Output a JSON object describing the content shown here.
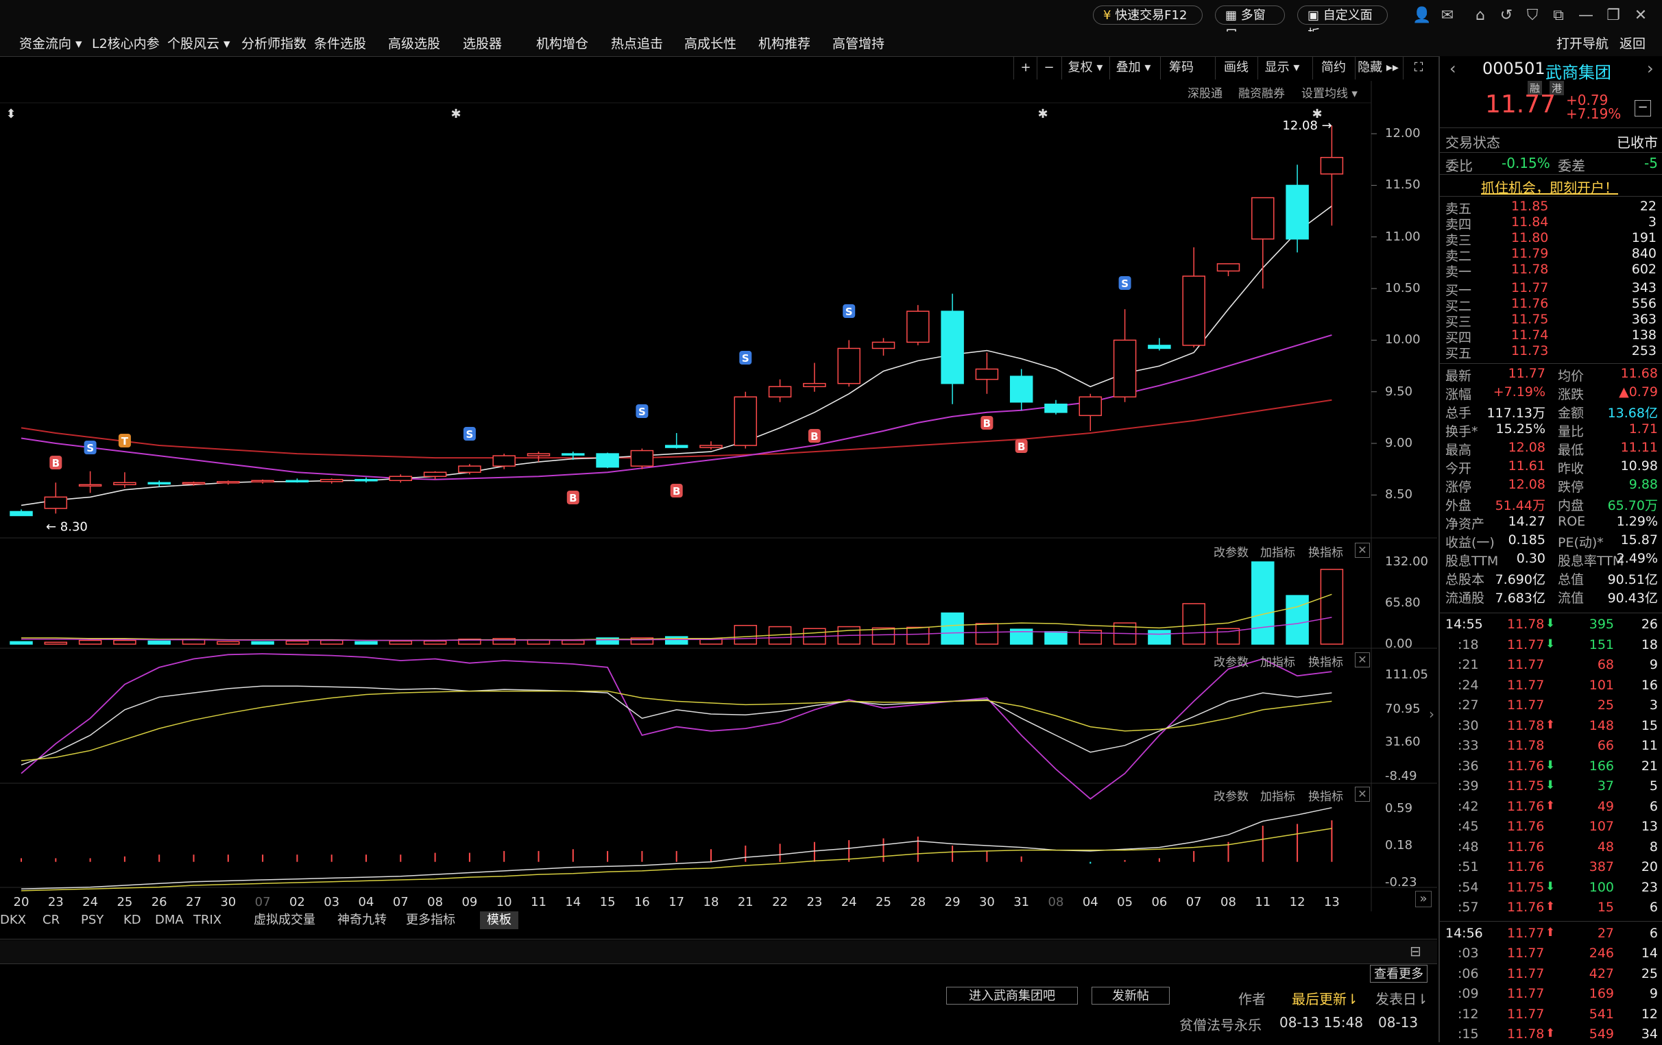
{
  "titlebar": {
    "trade_btn": "快速交易F12",
    "multi_window": "多窗口",
    "custom_panel": "自定义面板"
  },
  "menu": [
    {
      "label": "资金流向 ▾"
    },
    {
      "label": "L2核心内参"
    },
    {
      "label": "个股风云 ▾"
    },
    {
      "label": "分析师指数"
    },
    {
      "label": "条件选股"
    },
    {
      "label": "高级选股"
    },
    {
      "label": "选股器"
    },
    {
      "label": "机构增仓"
    },
    {
      "label": "热点追击"
    },
    {
      "label": "高成长性"
    },
    {
      "label": "机构推荐"
    },
    {
      "label": "高管增持"
    }
  ],
  "menu_right": {
    "open_nav": "打开导航",
    "back": "返回"
  },
  "toolbar": {
    "plus": "+",
    "minus": "−",
    "fuquan": "复权 ▾",
    "diejia": "叠加 ▾",
    "chouma": "筹码",
    "huaxian": "画线",
    "xianshi": "显示 ▾",
    "jianyue": "简约",
    "yincang": "隐藏 ▸▸"
  },
  "subtoolbar": {
    "sgt": "深股通",
    "rzrq": "融资融券",
    "ma_set": "设置均线 ▾"
  },
  "panel_controls": {
    "params": "改参数",
    "add": "加指标",
    "switch": "换指标"
  },
  "price_axis": [
    "12.00",
    "11.50",
    "11.00",
    "10.50",
    "10.00",
    "9.50",
    "9.00",
    "8.50"
  ],
  "vol_axis": [
    "132.00",
    "65.80",
    "0.00"
  ],
  "kd_axis": [
    "111.05",
    "70.95",
    "31.60",
    "-8.49"
  ],
  "macd_axis": [
    "0.59",
    "0.18",
    "-0.23"
  ],
  "high_label": "12.08",
  "low_label": "8.30",
  "x_labels": [
    "20",
    "23",
    "24",
    "25",
    "26",
    "27",
    "30",
    "07",
    "02",
    "03",
    "04",
    "07",
    "08",
    "09",
    "10",
    "11",
    "14",
    "15",
    "16",
    "17",
    "18",
    "21",
    "22",
    "23",
    "24",
    "25",
    "28",
    "29",
    "30",
    "31",
    "08",
    "04",
    "05",
    "06",
    "07",
    "08",
    "11",
    "12",
    "13"
  ],
  "indicator_tabs": [
    "DKX",
    "CR",
    "PSY",
    "KD",
    "DMA",
    "TRIX",
    "虚拟成交量",
    "神奇九转",
    "更多指标",
    "模板"
  ],
  "bottom": {
    "enter_forum": "进入武商集团吧",
    "post": "发新帖",
    "more": "查看更多",
    "author_col": "作者",
    "update_col": "最后更新⇂",
    "post_col": "发表日⇂",
    "rows": [
      {
        "author": "贫僧法号永乐",
        "updated": "08-13 15:48",
        "posted": "08-13"
      }
    ]
  },
  "stock": {
    "code": "000501",
    "name": "武商集团",
    "tag1": "融",
    "tag2": "港",
    "price": "11.77",
    "change": "+0.79",
    "change_pct": "+7.19%",
    "status_label": "交易状态",
    "status": "已收市",
    "weibi_label": "委比",
    "weibi": "-0.15%",
    "weicha_label": "委差",
    "weicha": "-5",
    "promo": "抓住机会，即刻开户！"
  },
  "asks": [
    {
      "label": "卖五",
      "price": "11.85",
      "vol": "22"
    },
    {
      "label": "卖四",
      "price": "11.84",
      "vol": "3"
    },
    {
      "label": "卖三",
      "price": "11.80",
      "vol": "191"
    },
    {
      "label": "卖二",
      "price": "11.79",
      "vol": "840"
    },
    {
      "label": "卖一",
      "price": "11.78",
      "vol": "602"
    }
  ],
  "bids": [
    {
      "label": "买一",
      "price": "11.77",
      "vol": "343"
    },
    {
      "label": "买二",
      "price": "11.76",
      "vol": "556"
    },
    {
      "label": "买三",
      "price": "11.75",
      "vol": "363"
    },
    {
      "label": "买四",
      "price": "11.74",
      "vol": "138"
    },
    {
      "label": "买五",
      "price": "11.73",
      "vol": "253"
    }
  ],
  "quote": [
    {
      "l1": "最新",
      "v1": "11.77",
      "c1": "red",
      "l2": "均价",
      "v2": "11.68",
      "c2": "red"
    },
    {
      "l1": "涨幅",
      "v1": "+7.19%",
      "c1": "red",
      "l2": "涨跌",
      "v2": "▲0.79",
      "c2": "red"
    },
    {
      "l1": "总手",
      "v1": "117.13万",
      "c1": "white",
      "l2": "金额",
      "v2": "13.68亿",
      "c2": "cyan"
    },
    {
      "l1": "换手*",
      "v1": "15.25%",
      "c1": "white",
      "l2": "量比",
      "v2": "1.71",
      "c2": "red"
    },
    {
      "l1": "最高",
      "v1": "12.08",
      "c1": "red",
      "l2": "最低",
      "v2": "11.11",
      "c2": "red"
    },
    {
      "l1": "今开",
      "v1": "11.61",
      "c1": "red",
      "l2": "昨收",
      "v2": "10.98",
      "c2": "white"
    },
    {
      "l1": "涨停",
      "v1": "12.08",
      "c1": "red",
      "l2": "跌停",
      "v2": "9.88",
      "c2": "green"
    },
    {
      "l1": "外盘",
      "v1": "51.44万",
      "c1": "red",
      "l2": "内盘",
      "v2": "65.70万",
      "c2": "green"
    },
    {
      "l1": "净资产",
      "v1": "14.27",
      "c1": "white",
      "l2": "ROE",
      "v2": "1.29%",
      "c2": "white"
    },
    {
      "l1": "收益(一)",
      "v1": "0.185",
      "c1": "white",
      "l2": "PE(动)*",
      "v2": "15.87",
      "c2": "white"
    },
    {
      "l1": "股息TTM",
      "v1": "0.30",
      "c1": "white",
      "l2": "股息率TTM",
      "v2": "2.49%",
      "c2": "white"
    },
    {
      "l1": "总股本",
      "v1": "7.690亿",
      "c1": "white",
      "l2": "总值",
      "v2": "90.51亿",
      "c2": "white"
    },
    {
      "l1": "流通股",
      "v1": "7.683亿",
      "c1": "white",
      "l2": "流值",
      "v2": "90.43亿",
      "c2": "white"
    }
  ],
  "ticks": [
    {
      "t": "14:55",
      "p": "11.78",
      "arrow": "⬇",
      "ac": "green",
      "v": "395",
      "vc": "green",
      "n": "26"
    },
    {
      "t": ":18",
      "p": "11.77",
      "arrow": "⬇",
      "ac": "green",
      "v": "151",
      "vc": "green",
      "n": "18"
    },
    {
      "t": ":21",
      "p": "11.77",
      "arrow": "",
      "ac": "red",
      "v": "68",
      "vc": "red",
      "n": "9"
    },
    {
      "t": ":24",
      "p": "11.77",
      "arrow": "",
      "ac": "red",
      "v": "101",
      "vc": "red",
      "n": "16"
    },
    {
      "t": ":27",
      "p": "11.77",
      "arrow": "",
      "ac": "red",
      "v": "25",
      "vc": "red",
      "n": "3"
    },
    {
      "t": ":30",
      "p": "11.78",
      "arrow": "⬆",
      "ac": "red",
      "v": "148",
      "vc": "red",
      "n": "15"
    },
    {
      "t": ":33",
      "p": "11.78",
      "arrow": "",
      "ac": "red",
      "v": "66",
      "vc": "red",
      "n": "11"
    },
    {
      "t": ":36",
      "p": "11.76",
      "arrow": "⬇",
      "ac": "green",
      "v": "166",
      "vc": "green",
      "n": "21"
    },
    {
      "t": ":39",
      "p": "11.75",
      "arrow": "⬇",
      "ac": "green",
      "v": "37",
      "vc": "green",
      "n": "5"
    },
    {
      "t": ":42",
      "p": "11.76",
      "arrow": "⬆",
      "ac": "red",
      "v": "49",
      "vc": "red",
      "n": "6"
    },
    {
      "t": ":45",
      "p": "11.76",
      "arrow": "",
      "ac": "red",
      "v": "107",
      "vc": "red",
      "n": "13"
    },
    {
      "t": ":48",
      "p": "11.76",
      "arrow": "",
      "ac": "red",
      "v": "48",
      "vc": "red",
      "n": "8"
    },
    {
      "t": ":51",
      "p": "11.76",
      "arrow": "",
      "ac": "red",
      "v": "387",
      "vc": "red",
      "n": "20"
    },
    {
      "t": ":54",
      "p": "11.75",
      "arrow": "⬇",
      "ac": "green",
      "v": "100",
      "vc": "green",
      "n": "23"
    },
    {
      "t": ":57",
      "p": "11.76",
      "arrow": "⬆",
      "ac": "red",
      "v": "15",
      "vc": "red",
      "n": "6"
    },
    {
      "t": "14:56",
      "p": "11.77",
      "arrow": "⬆",
      "ac": "red",
      "v": "27",
      "vc": "red",
      "n": "6"
    },
    {
      "t": ":03",
      "p": "11.77",
      "arrow": "",
      "ac": "red",
      "v": "246",
      "vc": "red",
      "n": "14"
    },
    {
      "t": ":06",
      "p": "11.77",
      "arrow": "",
      "ac": "red",
      "v": "427",
      "vc": "red",
      "n": "25"
    },
    {
      "t": ":09",
      "p": "11.77",
      "arrow": "",
      "ac": "red",
      "v": "169",
      "vc": "red",
      "n": "9"
    },
    {
      "t": ":12",
      "p": "11.77",
      "arrow": "",
      "ac": "red",
      "v": "541",
      "vc": "red",
      "n": "12"
    },
    {
      "t": ":15",
      "p": "11.78",
      "arrow": "⬆",
      "ac": "red",
      "v": "549",
      "vc": "red",
      "n": "34"
    }
  ],
  "chart_data": {
    "type": "candlestick",
    "price_range": [
      8.25,
      12.2
    ],
    "candles": [
      {
        "o": 8.34,
        "h": 8.36,
        "l": 8.3,
        "c": 8.3
      },
      {
        "o": 8.37,
        "h": 8.62,
        "l": 8.32,
        "c": 8.48
      },
      {
        "o": 8.6,
        "h": 8.73,
        "l": 8.52,
        "c": 8.6
      },
      {
        "o": 8.6,
        "h": 8.72,
        "l": 8.57,
        "c": 8.62
      },
      {
        "o": 8.62,
        "h": 8.64,
        "l": 8.58,
        "c": 8.61
      },
      {
        "o": 8.61,
        "h": 8.63,
        "l": 8.59,
        "c": 8.62
      },
      {
        "o": 8.62,
        "h": 8.64,
        "l": 8.6,
        "c": 8.63
      },
      {
        "o": 8.63,
        "h": 8.65,
        "l": 8.61,
        "c": 8.64
      },
      {
        "o": 8.64,
        "h": 8.66,
        "l": 8.62,
        "c": 8.63
      },
      {
        "o": 8.63,
        "h": 8.66,
        "l": 8.61,
        "c": 8.65
      },
      {
        "o": 8.65,
        "h": 8.67,
        "l": 8.62,
        "c": 8.64
      },
      {
        "o": 8.64,
        "h": 8.7,
        "l": 8.62,
        "c": 8.68
      },
      {
        "o": 8.68,
        "h": 8.73,
        "l": 8.65,
        "c": 8.72
      },
      {
        "o": 8.72,
        "h": 8.8,
        "l": 8.7,
        "c": 8.78
      },
      {
        "o": 8.78,
        "h": 8.9,
        "l": 8.75,
        "c": 8.88
      },
      {
        "o": 8.88,
        "h": 8.92,
        "l": 8.82,
        "c": 8.9
      },
      {
        "o": 8.9,
        "h": 8.92,
        "l": 8.84,
        "c": 8.89
      },
      {
        "o": 8.9,
        "h": 8.91,
        "l": 8.76,
        "c": 8.77
      },
      {
        "o": 8.78,
        "h": 8.95,
        "l": 8.75,
        "c": 8.93
      },
      {
        "o": 8.98,
        "h": 9.1,
        "l": 8.95,
        "c": 8.96
      },
      {
        "o": 8.96,
        "h": 9.02,
        "l": 8.94,
        "c": 8.98
      },
      {
        "o": 8.98,
        "h": 9.5,
        "l": 8.95,
        "c": 9.45
      },
      {
        "o": 9.45,
        "h": 9.62,
        "l": 9.4,
        "c": 9.55
      },
      {
        "o": 9.55,
        "h": 9.78,
        "l": 9.5,
        "c": 9.58
      },
      {
        "o": 9.58,
        "h": 10.0,
        "l": 9.55,
        "c": 9.92
      },
      {
        "o": 9.92,
        "h": 10.02,
        "l": 9.85,
        "c": 9.98
      },
      {
        "o": 9.98,
        "h": 10.34,
        "l": 9.95,
        "c": 10.28
      },
      {
        "o": 10.28,
        "h": 10.45,
        "l": 9.38,
        "c": 9.58
      },
      {
        "o": 9.62,
        "h": 9.88,
        "l": 9.48,
        "c": 9.72
      },
      {
        "o": 9.65,
        "h": 9.72,
        "l": 9.32,
        "c": 9.4
      },
      {
        "o": 9.38,
        "h": 9.42,
        "l": 9.28,
        "c": 9.3
      },
      {
        "o": 9.27,
        "h": 9.48,
        "l": 9.12,
        "c": 9.45
      },
      {
        "o": 9.45,
        "h": 10.3,
        "l": 9.4,
        "c": 10.0
      },
      {
        "o": 9.95,
        "h": 10.02,
        "l": 9.9,
        "c": 9.92
      },
      {
        "o": 9.95,
        "h": 10.9,
        "l": 9.93,
        "c": 10.62
      },
      {
        "o": 10.67,
        "h": 10.74,
        "l": 10.62,
        "c": 10.74
      },
      {
        "o": 10.98,
        "h": 11.38,
        "l": 10.5,
        "c": 11.38
      },
      {
        "o": 11.5,
        "h": 11.7,
        "l": 10.85,
        "c": 10.98
      },
      {
        "o": 11.61,
        "h": 12.08,
        "l": 11.11,
        "c": 11.77
      }
    ],
    "ma5": [
      8.4,
      8.45,
      8.48,
      8.55,
      8.58,
      8.6,
      8.62,
      8.63,
      8.63,
      8.64,
      8.64,
      8.66,
      8.68,
      8.72,
      8.78,
      8.82,
      8.85,
      8.86,
      8.88,
      8.9,
      8.92,
      9.02,
      9.15,
      9.3,
      9.48,
      9.7,
      9.8,
      9.86,
      9.9,
      9.82,
      9.72,
      9.55,
      9.68,
      9.75,
      9.88,
      10.3,
      10.7,
      11.05,
      11.3
    ],
    "ma_slow": [
      9.05,
      9.0,
      8.96,
      8.92,
      8.88,
      8.84,
      8.8,
      8.76,
      8.72,
      8.7,
      8.68,
      8.66,
      8.65,
      8.66,
      8.67,
      8.68,
      8.7,
      8.72,
      8.76,
      8.8,
      8.84,
      8.88,
      8.93,
      8.98,
      9.05,
      9.12,
      9.2,
      9.26,
      9.3,
      9.32,
      9.36,
      9.4,
      9.48,
      9.56,
      9.65,
      9.75,
      9.85,
      9.95,
      10.05
    ],
    "ma_long": [
      9.15,
      9.1,
      9.06,
      9.02,
      8.98,
      8.96,
      8.94,
      8.92,
      8.9,
      8.89,
      8.88,
      8.87,
      8.86,
      8.86,
      8.86,
      8.86,
      8.86,
      8.86,
      8.86,
      8.87,
      8.88,
      8.89,
      8.9,
      8.92,
      8.94,
      8.96,
      8.98,
      9.0,
      9.02,
      9.04,
      9.07,
      9.1,
      9.14,
      9.18,
      9.22,
      9.27,
      9.32,
      9.37,
      9.42
    ],
    "volume": [
      4,
      3,
      6,
      6,
      5,
      7,
      4,
      4,
      5,
      6,
      4,
      5,
      5,
      8,
      9,
      7,
      6,
      10,
      10,
      12,
      9,
      30,
      28,
      25,
      28,
      26,
      27,
      50,
      33,
      24,
      20,
      22,
      34,
      22,
      65,
      25,
      132,
      78,
      120
    ],
    "vol_up": [
      false,
      true,
      true,
      true,
      false,
      true,
      true,
      false,
      true,
      true,
      false,
      true,
      true,
      true,
      true,
      true,
      true,
      false,
      true,
      false,
      true,
      true,
      true,
      true,
      true,
      true,
      true,
      false,
      true,
      false,
      false,
      true,
      true,
      false,
      true,
      true,
      false,
      false,
      true
    ],
    "vol_ma": [
      10,
      10,
      9,
      9,
      8,
      8,
      7,
      7,
      7,
      7,
      6,
      6,
      6,
      7,
      7,
      7,
      7,
      8,
      8,
      9,
      9,
      12,
      15,
      18,
      22,
      24,
      26,
      30,
      32,
      34,
      33,
      30,
      28,
      26,
      30,
      34,
      48,
      60,
      80
    ],
    "vol_range": [
      0,
      132
    ],
    "kd_k": [
      5,
      20,
      40,
      70,
      85,
      90,
      95,
      98,
      98,
      97,
      96,
      94,
      95,
      92,
      94,
      93,
      92,
      90,
      60,
      70,
      65,
      64,
      68,
      75,
      80,
      76,
      78,
      80,
      82,
      60,
      40,
      20,
      28,
      45,
      62,
      80,
      90,
      85,
      90
    ],
    "kd_d": [
      10,
      14,
      22,
      35,
      48,
      58,
      66,
      73,
      79,
      84,
      88,
      90,
      91,
      92,
      92,
      92,
      92,
      92,
      84,
      80,
      78,
      76,
      77,
      78,
      80,
      79,
      79,
      80,
      81,
      74,
      63,
      50,
      45,
      47,
      52,
      60,
      70,
      75,
      80
    ],
    "kd_j": [
      -5,
      30,
      60,
      100,
      120,
      130,
      135,
      136,
      135,
      134,
      132,
      128,
      130,
      125,
      128,
      126,
      124,
      120,
      40,
      50,
      45,
      48,
      55,
      70,
      82,
      72,
      76,
      80,
      84,
      40,
      0,
      -35,
      -5,
      40,
      80,
      118,
      130,
      110,
      115
    ],
    "kd_range": [
      -8.49,
      111.05
    ],
    "macd_dif": [
      -0.3,
      -0.29,
      -0.28,
      -0.26,
      -0.24,
      -0.22,
      -0.21,
      -0.2,
      -0.19,
      -0.18,
      -0.17,
      -0.16,
      -0.14,
      -0.12,
      -0.1,
      -0.08,
      -0.06,
      -0.05,
      -0.04,
      -0.02,
      0.0,
      0.05,
      0.08,
      0.12,
      0.15,
      0.19,
      0.23,
      0.2,
      0.18,
      0.16,
      0.13,
      0.12,
      0.14,
      0.16,
      0.22,
      0.3,
      0.45,
      0.52,
      0.6
    ],
    "macd_dea": [
      -0.32,
      -0.31,
      -0.3,
      -0.29,
      -0.28,
      -0.26,
      -0.25,
      -0.24,
      -0.23,
      -0.22,
      -0.21,
      -0.2,
      -0.19,
      -0.17,
      -0.16,
      -0.14,
      -0.13,
      -0.11,
      -0.1,
      -0.08,
      -0.07,
      -0.04,
      -0.02,
      0.01,
      0.03,
      0.06,
      0.09,
      0.11,
      0.12,
      0.13,
      0.13,
      0.13,
      0.13,
      0.14,
      0.16,
      0.19,
      0.25,
      0.31,
      0.37
    ],
    "macd_range": [
      -0.23,
      0.59
    ]
  }
}
